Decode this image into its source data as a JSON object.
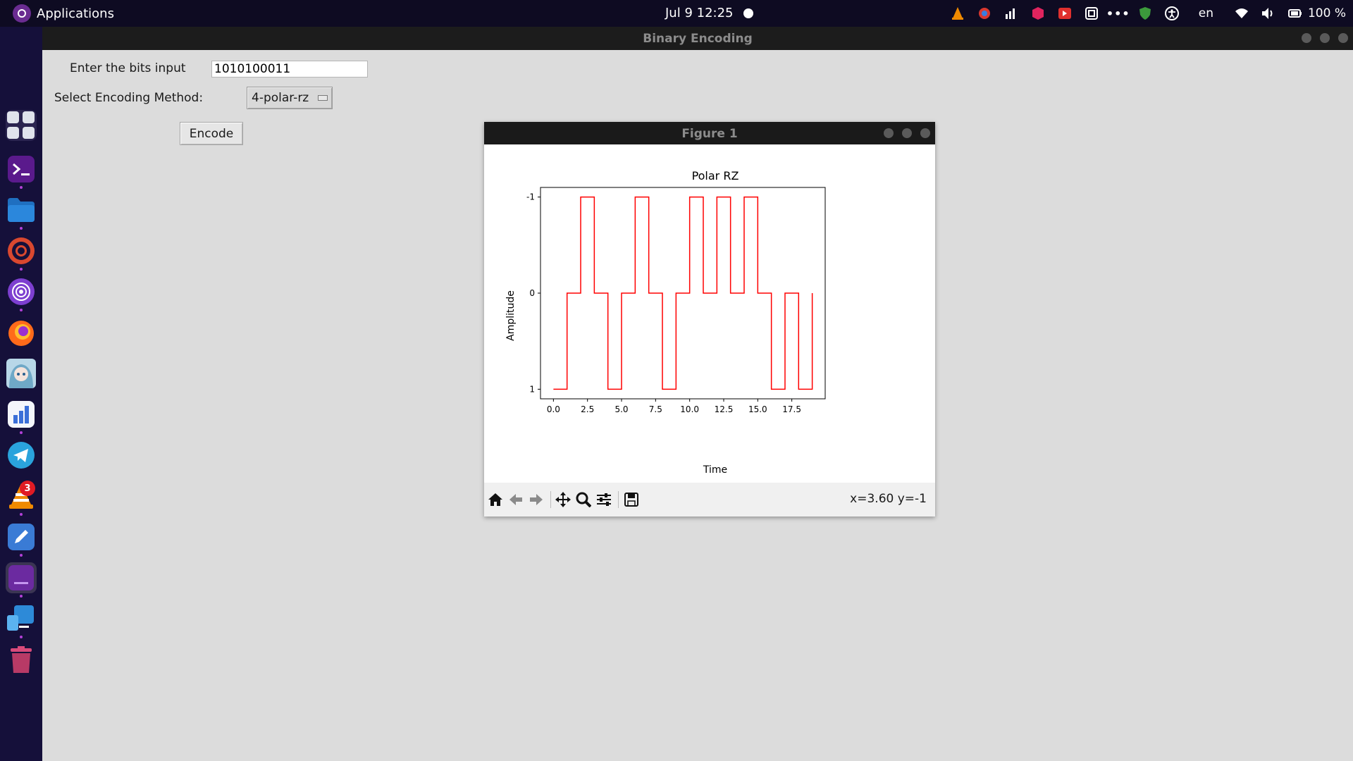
{
  "topbar": {
    "apps_label": "Applications",
    "clock": "Jul 9  12:25",
    "language": "en",
    "battery": "100 %"
  },
  "dock": {
    "items": [
      {
        "icon": "app-grid-icon"
      },
      {
        "icon": "terminal-icon"
      },
      {
        "icon": "files-icon"
      },
      {
        "icon": "chrome-icon"
      },
      {
        "icon": "tor-browser-icon"
      },
      {
        "icon": "firefox-icon"
      },
      {
        "icon": "anime-avatar-app-icon"
      },
      {
        "icon": "analytics-icon"
      },
      {
        "icon": "telegram-icon"
      },
      {
        "icon": "vlc-icon",
        "badge": "3"
      },
      {
        "icon": "text-editor-icon"
      },
      {
        "icon": "active-terminal-icon"
      },
      {
        "icon": "remote-desktop-icon"
      },
      {
        "icon": "trash-icon"
      }
    ]
  },
  "main_window": {
    "title": "Binary Encoding",
    "bits_label": "Enter the bits input",
    "bits_value": "1010100011",
    "method_label": "Select Encoding Method:",
    "method_value": "4-polar-rz",
    "encode_button": "Encode"
  },
  "figure_window": {
    "title": "Figure 1",
    "coords_readout": "x=3.60 y=-1",
    "toolbar": [
      "home-icon",
      "back-arrow-icon",
      "forward-arrow-icon",
      "pan-icon",
      "zoom-icon",
      "configure-subplots-icon",
      "save-icon"
    ]
  },
  "chart_data": {
    "type": "line",
    "title": "Polar RZ",
    "xlabel": "Time",
    "ylabel": "Amplitude",
    "xlim": [
      -0.95,
      19.95
    ],
    "ylim": [
      1.1,
      -1.1
    ],
    "xticks": [
      0.0,
      2.5,
      5.0,
      7.5,
      10.0,
      12.5,
      15.0,
      17.5
    ],
    "xtick_labels": [
      "0.0",
      "2.5",
      "5.0",
      "7.5",
      "10.0",
      "12.5",
      "15.0",
      "17.5"
    ],
    "yticks": [
      -1,
      0,
      1
    ],
    "ytick_labels": [
      "-1",
      "0",
      "1"
    ],
    "grid": false,
    "color": "#ff0000",
    "step": "post",
    "series": [
      {
        "x": [
          0,
          1,
          2,
          3,
          4,
          5,
          6,
          7,
          8,
          9,
          10,
          11,
          12,
          13,
          14,
          15,
          16,
          17,
          18,
          19
        ],
        "y": [
          1,
          0,
          -1,
          0,
          1,
          0,
          -1,
          0,
          1,
          0,
          -1,
          0,
          -1,
          0,
          -1,
          0,
          1,
          0,
          1,
          0
        ]
      }
    ]
  }
}
